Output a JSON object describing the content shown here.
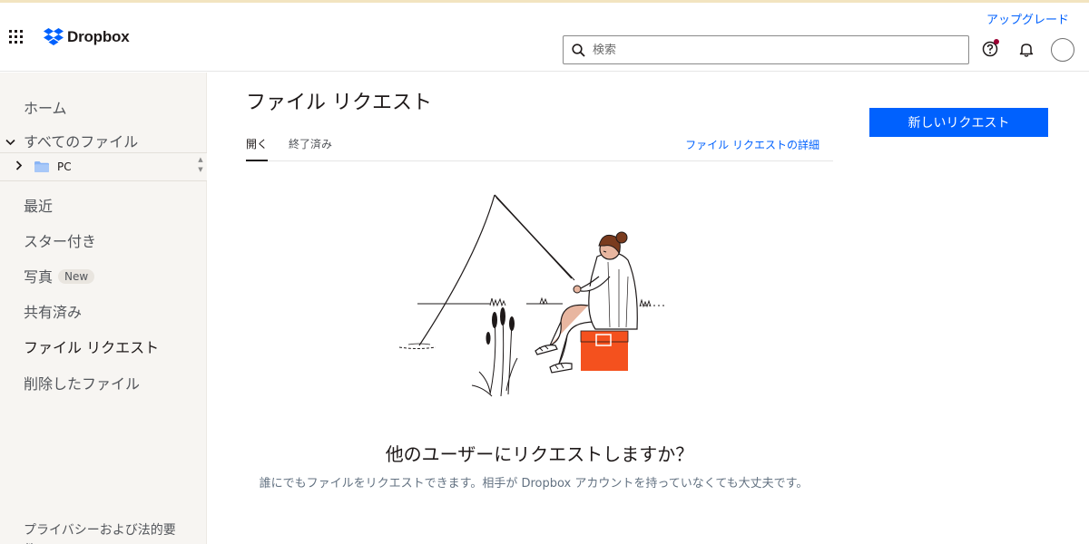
{
  "header": {
    "app_name": "Dropbox",
    "upgrade_link": "アップグレード",
    "search_placeholder": "検索",
    "icons": [
      "apps-grid-icon",
      "dropbox-logo-icon",
      "search-icon",
      "help-icon",
      "bell-icon",
      "avatar"
    ]
  },
  "sidebar": {
    "items": [
      {
        "label": "ホーム"
      },
      {
        "label": "すべてのファイル"
      },
      {
        "label": "最近"
      },
      {
        "label": "スター付き"
      },
      {
        "label": "写真",
        "badge": "New"
      },
      {
        "label": "共有済み"
      },
      {
        "label": "ファイル リクエスト",
        "active": true
      },
      {
        "label": "削除したファイル"
      }
    ],
    "tree": {
      "folder": "PC"
    },
    "footer_link": "プライバシーおよび法的要件"
  },
  "main": {
    "title": "ファイル リクエスト",
    "tabs": [
      {
        "label": "開く",
        "active": true
      },
      {
        "label": "終了済み",
        "active": false
      }
    ],
    "details_link": "ファイル リクエストの詳細",
    "new_request_button": "新しいリクエスト",
    "empty_state": {
      "title": "他のユーザーにリクエストしますか？",
      "text": "誰にでもファイルをリクエストできます。相手が Dropbox アカウントを持っていなくても大丈夫です。"
    }
  },
  "colors": {
    "accent": "#0061fe",
    "sidebar_bg": "#f7f5f2",
    "cooler": "#f4511e",
    "text": "#1e1919"
  }
}
